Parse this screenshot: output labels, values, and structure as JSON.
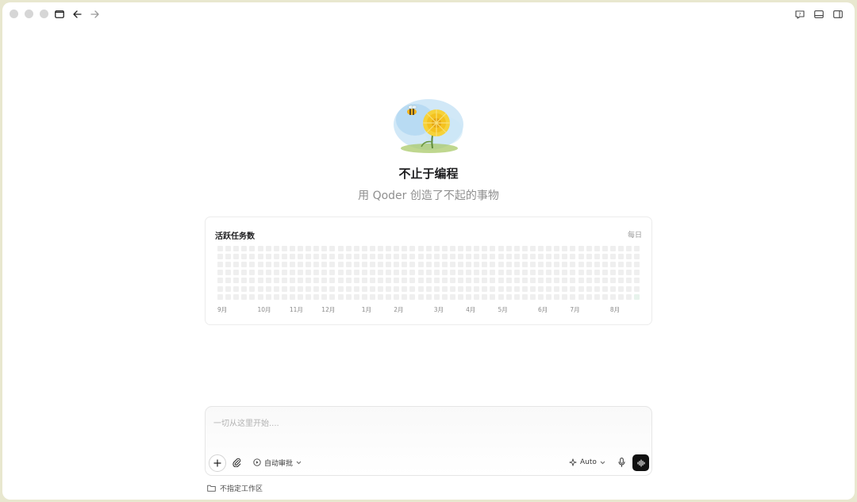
{
  "window": {
    "traffic_lights": [
      "close",
      "minimize",
      "zoom"
    ],
    "toolbar_left_icons": [
      "sidebar-toggle-icon",
      "back-arrow-icon",
      "forward-arrow-icon"
    ],
    "toolbar_right_icons": [
      "feedback-icon",
      "bottom-panel-icon",
      "right-panel-icon"
    ]
  },
  "hero": {
    "image": "dandelion-and-bee-illustration",
    "title": "不止于编程",
    "subtitle": "用 Qoder 创造了不起的事物"
  },
  "activity_card": {
    "title": "活跃任务数",
    "range_label": "每日",
    "weeks": 53,
    "days_per_week": 7,
    "active_cells": [
      {
        "week": 52,
        "day": 6
      }
    ],
    "months": [
      {
        "label": "9月",
        "week": 0
      },
      {
        "label": "10月",
        "week": 5
      },
      {
        "label": "11月",
        "week": 9
      },
      {
        "label": "12月",
        "week": 13
      },
      {
        "label": "1月",
        "week": 18
      },
      {
        "label": "2月",
        "week": 22
      },
      {
        "label": "3月",
        "week": 27
      },
      {
        "label": "4月",
        "week": 31
      },
      {
        "label": "5月",
        "week": 35
      },
      {
        "label": "6月",
        "week": 40
      },
      {
        "label": "7月",
        "week": 44
      },
      {
        "label": "8月",
        "week": 49
      }
    ],
    "colors": {
      "empty": "#efefef",
      "active": "#e7f3ec"
    }
  },
  "composer": {
    "placeholder": "一切从这里开始....",
    "approve_label": "自动审批",
    "model_label": "Auto",
    "icons": [
      "plus-icon",
      "paperclip-icon",
      "play-circle-icon",
      "chevron-down-icon",
      "sparkle-icon",
      "microphone-icon",
      "voice-waveform-icon"
    ]
  },
  "workspace": {
    "label": "不指定工作区",
    "icon": "folder-icon"
  }
}
